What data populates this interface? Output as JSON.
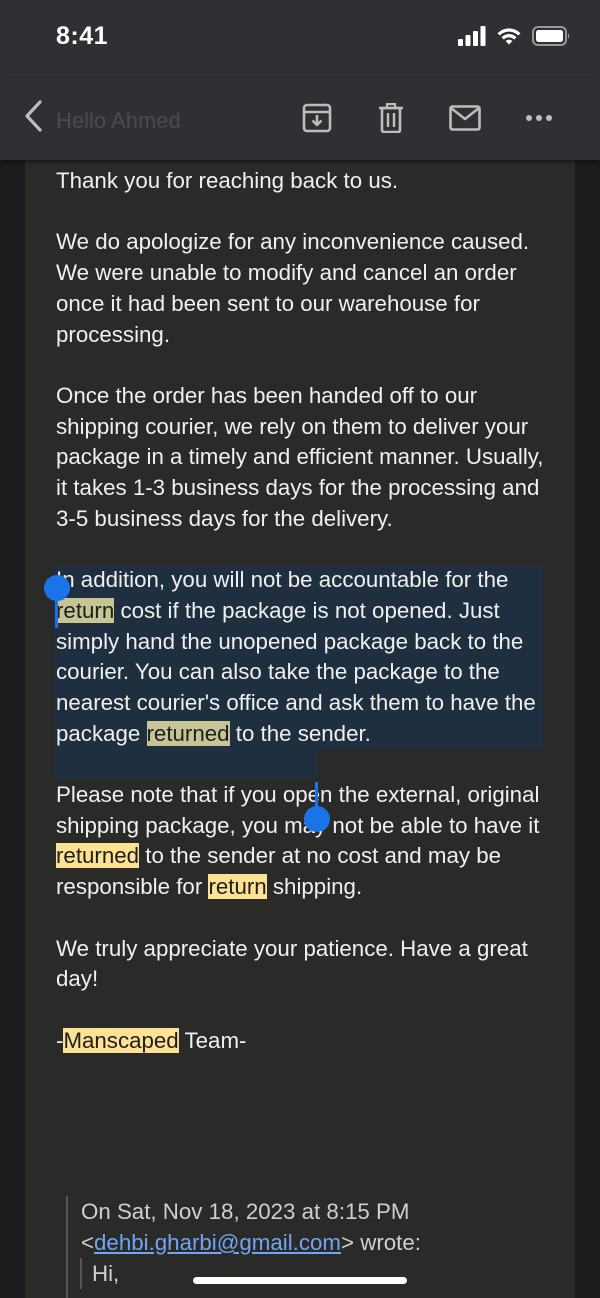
{
  "status_bar": {
    "time": "8:41"
  },
  "nav": {
    "title": "Hello Ahmed",
    "icons": [
      "back-chevron-icon",
      "archive-icon",
      "trash-icon",
      "mail-icon",
      "more-icon"
    ]
  },
  "email": {
    "p1": "Thank you for reaching back to us.",
    "p2": "We do apologize for any inconvenience caused. We were unable to modify and cancel an order once it had been sent to our warehouse for processing.",
    "p3": "Once the order has been handed off to our shipping courier, we rely on them to deliver your package in a timely and efficient manner. Usually, it takes 1-3 business days for the processing and 3-5 business days for the delivery.",
    "p4_a": "In addition, you will not be accountable for the ",
    "p4_hl1": "return",
    "p4_b": " cost if the package is not opened. Just simply hand the unopened package back to the courier. You can also take the package to the nearest courier's office and ask them to have the package ",
    "p4_hl2": "returned",
    "p4_c": " to the sender.",
    "p5_a": "Please note that if you open the external, original shipping package, you may not be able to have it ",
    "p5_hl1": "returned",
    "p5_b": " to the sender at no cost and may be responsible for ",
    "p5_hl2": "return",
    "p5_c": " shipping.",
    "p6": "We truly appreciate your patience. Have a great day!",
    "sig_a": "-",
    "sig_hl": "Manscaped",
    "sig_b": " Team-"
  },
  "quote": {
    "header_a": "On Sat, Nov 18, 2023 at 8:15 PM",
    "lt": "<",
    "email": "dehbi.gharbi@gmail.com",
    "header_b": "> wrote:",
    "greeting": "Hi,"
  },
  "colors": {
    "background": "#1b1c1e",
    "toolbar": "#2f3033",
    "highlight": "#fde293",
    "selection": "#1f2f3f",
    "handle": "#1a73e8",
    "link": "#6fa5f3"
  }
}
